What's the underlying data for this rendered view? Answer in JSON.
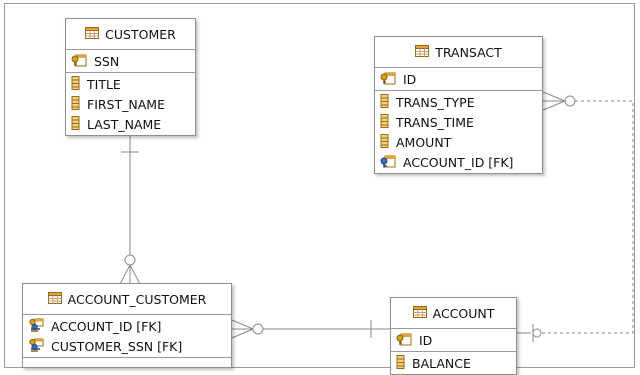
{
  "diagram": {
    "entities": {
      "customer": {
        "title": "CUSTOMER",
        "keys": [
          {
            "name": "SSN",
            "icon": "primary-key-icon"
          }
        ],
        "columns": [
          {
            "name": "TITLE",
            "icon": "column-icon"
          },
          {
            "name": "FIRST_NAME",
            "icon": "column-icon"
          },
          {
            "name": "LAST_NAME",
            "icon": "column-icon"
          }
        ]
      },
      "transact": {
        "title": "TRANSACT",
        "keys": [
          {
            "name": "ID",
            "icon": "primary-key-icon"
          }
        ],
        "columns": [
          {
            "name": "TRANS_TYPE",
            "icon": "column-icon"
          },
          {
            "name": "TRANS_TIME",
            "icon": "column-icon"
          },
          {
            "name": "AMOUNT",
            "icon": "column-icon"
          },
          {
            "name": "ACCOUNT_ID [FK]",
            "icon": "foreign-key-icon"
          }
        ]
      },
      "account_customer": {
        "title": "ACCOUNT_CUSTOMER",
        "keys": [
          {
            "name": "ACCOUNT_ID [FK]",
            "icon": "primary-foreign-key-icon"
          },
          {
            "name": "CUSTOMER_SSN [FK]",
            "icon": "primary-foreign-key-icon"
          }
        ],
        "columns": []
      },
      "account": {
        "title": "ACCOUNT",
        "keys": [
          {
            "name": "ID",
            "icon": "primary-key-icon"
          }
        ],
        "columns": [
          {
            "name": "BALANCE",
            "icon": "column-icon"
          }
        ]
      }
    },
    "relationships": [
      {
        "from": "CUSTOMER",
        "to": "ACCOUNT_CUSTOMER",
        "from_end": "one",
        "to_end": "zero-or-many",
        "line_style": "solid"
      },
      {
        "from": "ACCOUNT",
        "to": "ACCOUNT_CUSTOMER",
        "from_end": "one",
        "to_end": "zero-or-many",
        "line_style": "solid"
      },
      {
        "from": "ACCOUNT",
        "to": "TRANSACT",
        "from_end": "zero-or-one",
        "to_end": "zero-or-many",
        "line_style": "dashed"
      }
    ],
    "colors": {
      "border": "#8e8e8e",
      "line": "#8a8a8a",
      "table_icon_header": "#e2a33a",
      "column_icon": "#c98a1f",
      "key_gold": "#d9a21c",
      "key_blue": "#3d6fb7"
    }
  }
}
